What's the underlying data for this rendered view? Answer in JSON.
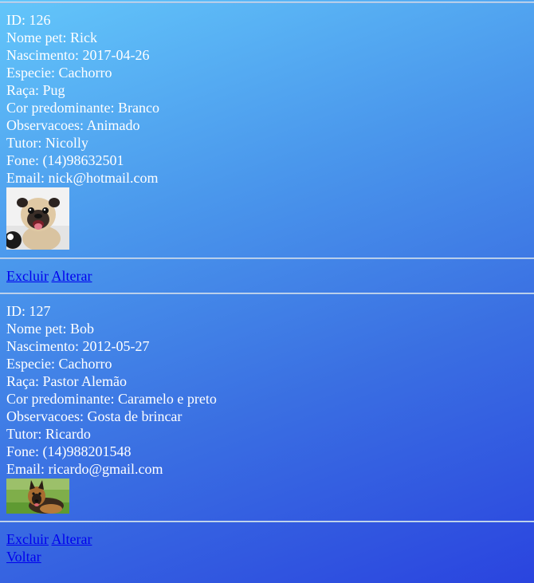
{
  "records": [
    {
      "id_line": "ID: 126",
      "nome_line": "Nome pet: Rick",
      "nascimento_line": "Nascimento: 2017-04-26",
      "especie_line": "Especie: Cachorro",
      "raca_line": "Raça: Pug",
      "cor_line": "Cor predominante: Branco",
      "obs_line": "Observacoes: Animado",
      "tutor_line": "Tutor: Nicolly",
      "fone_line": "Fone: (14)98632501",
      "email_line": "Email: nick@hotmail.com",
      "photo_icon": "pug-photo",
      "excluir_label": "Excluir",
      "alterar_label": "Alterar"
    },
    {
      "id_line": "ID: 127",
      "nome_line": "Nome pet: Bob",
      "nascimento_line": "Nascimento: 2012-05-27",
      "especie_line": "Especie: Cachorro",
      "raca_line": "Raça: Pastor Alemão",
      "cor_line": "Cor predominante: Caramelo e preto",
      "obs_line": "Observacoes: Gosta de brincar",
      "tutor_line": "Tutor: Ricardo",
      "fone_line": "Fone: (14)988201548",
      "email_line": "Email: ricardo@gmail.com",
      "photo_icon": "german-shepherd-photo",
      "excluir_label": "Excluir",
      "alterar_label": "Alterar"
    }
  ],
  "voltar_label": "Voltar",
  "colors": {
    "link": "#0000ee",
    "text": "#ffffff",
    "gradient_start": "#63c6fa",
    "gradient_end": "#2a44df"
  }
}
